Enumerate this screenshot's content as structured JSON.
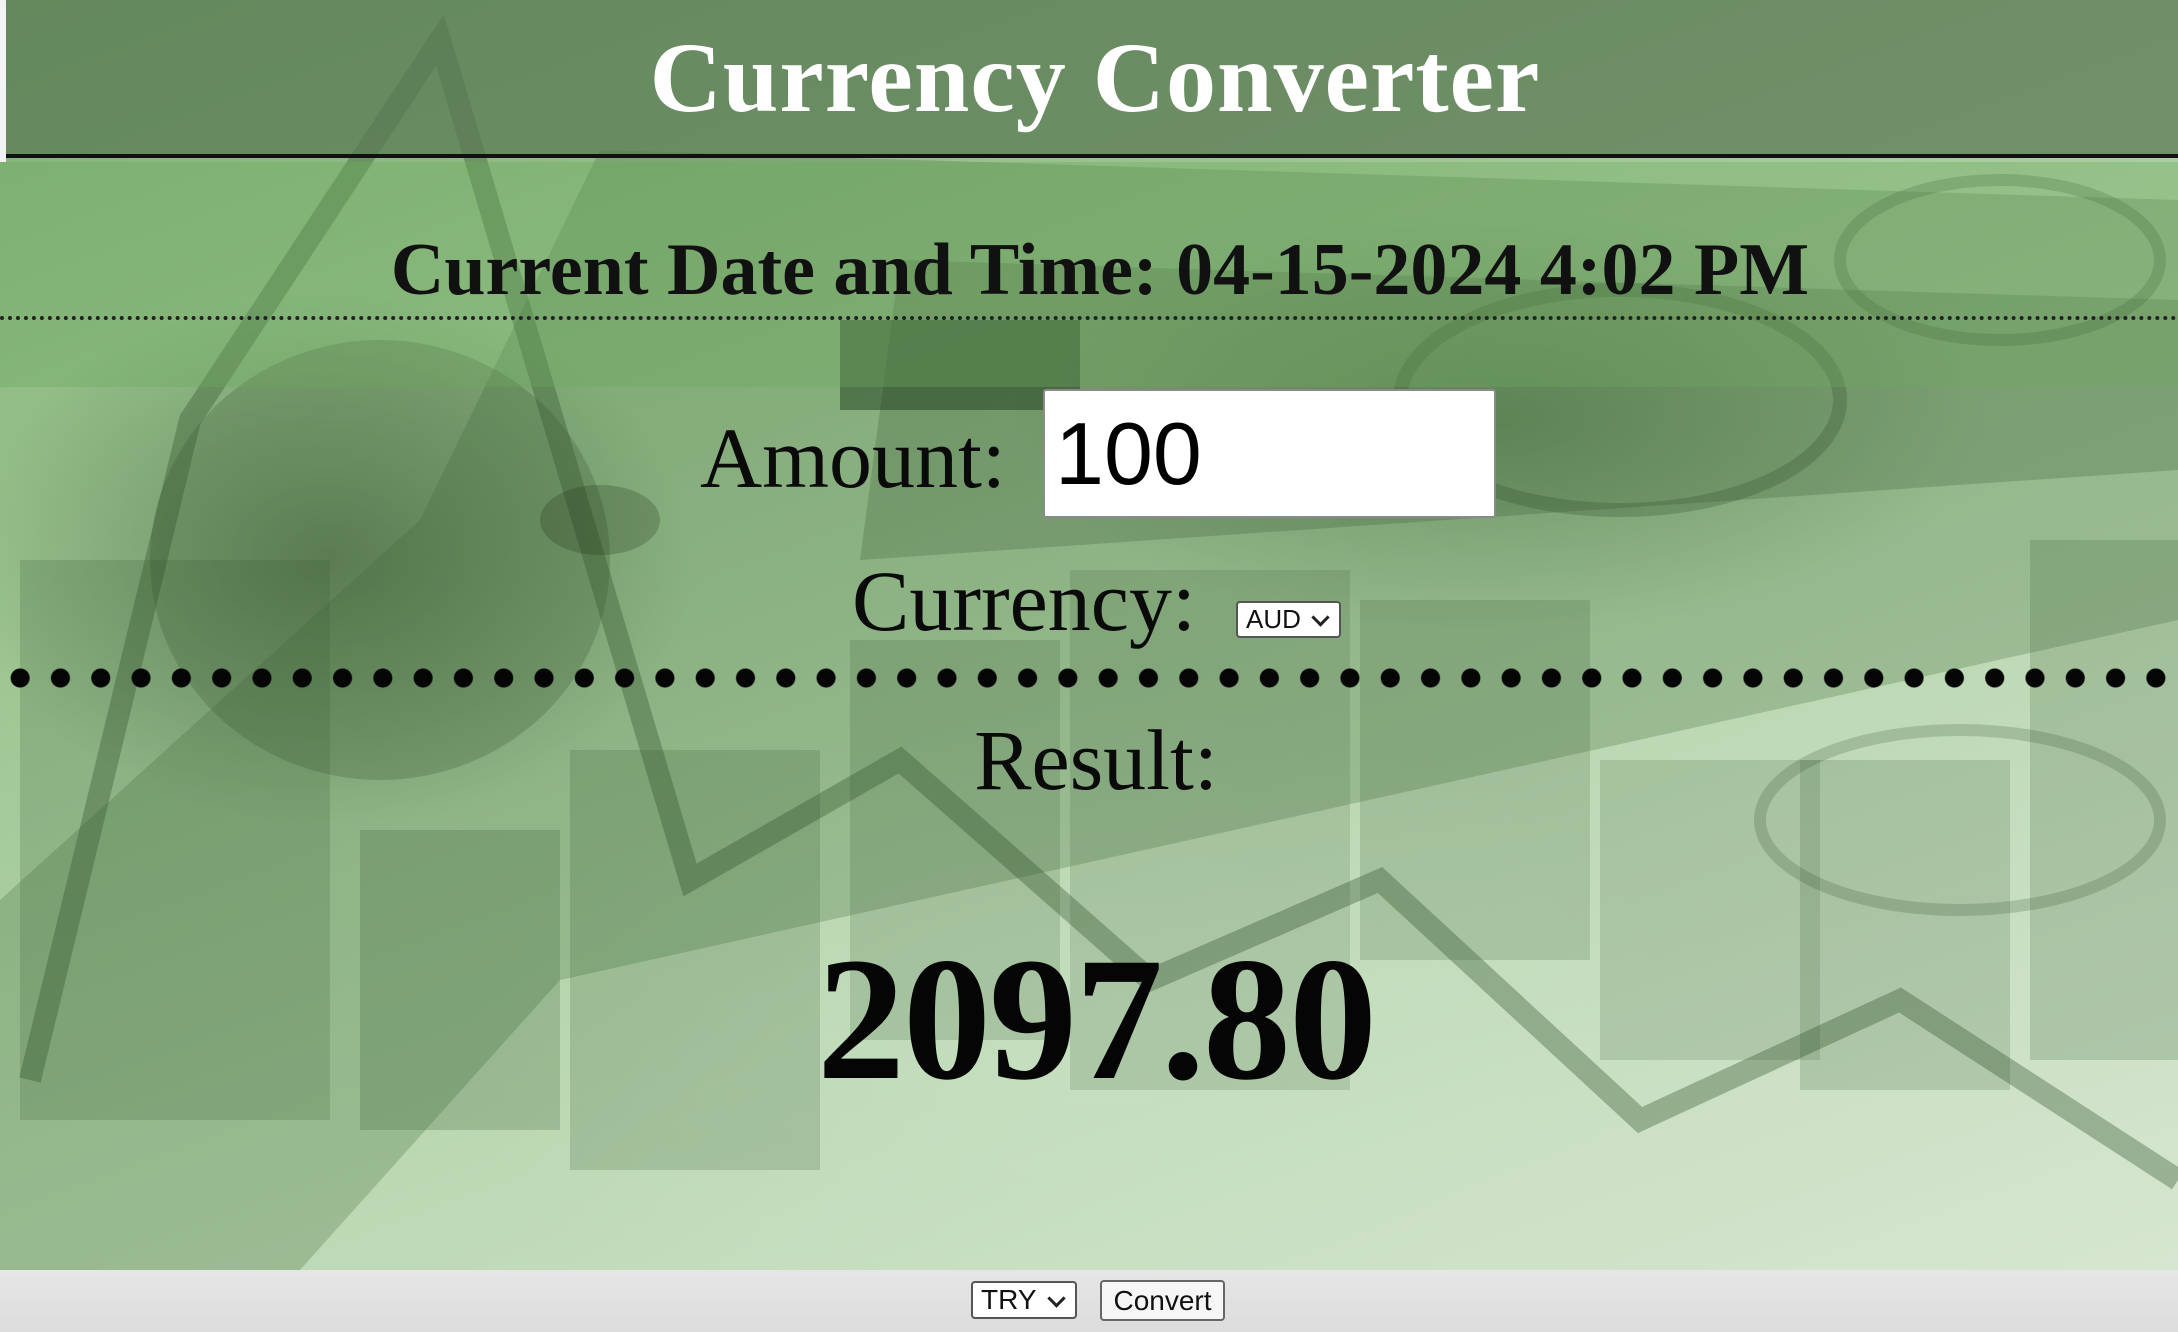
{
  "header": {
    "title": "Currency Converter"
  },
  "datetime": {
    "text": "Current Date and Time: 04-15-2024 4:02 PM"
  },
  "form": {
    "amount_label": "Amount:",
    "amount_value": "100",
    "currency_label": "Currency:",
    "currency_selected": "AUD"
  },
  "result": {
    "label": "Result:",
    "value": "2097.80"
  },
  "bottom_bar": {
    "target_currency_selected": "TRY",
    "convert_label": "Convert"
  },
  "colors": {
    "header_bg": "#5a7855",
    "page_green": "#9cc490",
    "title_text": "#ffffff",
    "body_text": "#0a0a0a",
    "bottom_bar": "#e2e2e2"
  },
  "icons": {
    "dropdown": "chevron-down-icon"
  }
}
